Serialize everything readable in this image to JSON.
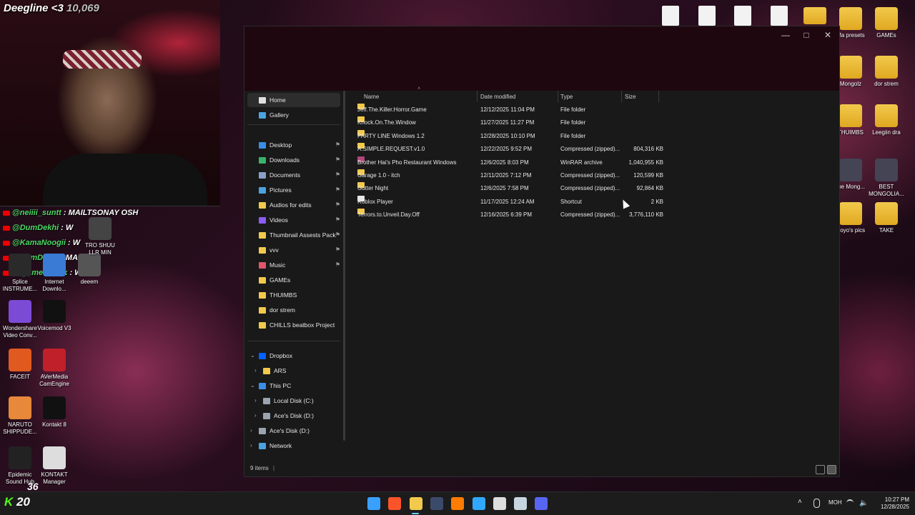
{
  "overlay": {
    "streamer_name": "Deegline <3",
    "streamer_count": "10,069",
    "sub_count": "20",
    "sub_prefix": "K",
    "sticker_count": "36",
    "chat": [
      {
        "user": "@neiiii_suntt",
        "message": "MAILTSONAY OSH"
      },
      {
        "user": "@DumDekhi",
        "message": "W"
      },
      {
        "user": "@KamaNoogii",
        "message": "W"
      },
      {
        "user": "@DumDekhi",
        "message": "MAIIIII"
      },
      {
        "user": "@fgame69-v1k",
        "message": "W"
      }
    ]
  },
  "desktop": {
    "left_icons": [
      {
        "label": "Splice INSTRUME..."
      },
      {
        "label": "Internet Downlo..."
      },
      {
        "label": "deeem"
      },
      {
        "label": "TRO SHUU LLR MIN"
      },
      {
        "label": "Wondershare Video Conv..."
      },
      {
        "label": "Voicemod V3"
      },
      {
        "label": "FACEIT"
      },
      {
        "label": "AVerMedia CamEngine"
      },
      {
        "label": "NARUTO SHIPPUDE..."
      },
      {
        "label": "Kontakt 8"
      },
      {
        "label": "Epidemic Sound Hub"
      },
      {
        "label": "KONTAKT Manager"
      }
    ],
    "right_icons": [
      {
        "label": "Ma presets"
      },
      {
        "label": "GAMEs"
      },
      {
        "label": "Mongolz"
      },
      {
        "label": "dor strem"
      },
      {
        "label": "THUIMBS"
      },
      {
        "label": "Leegiin dra"
      },
      {
        "label": "the Mong..."
      },
      {
        "label": "BEST MONGOLIA..."
      },
      {
        "label": "Soyo's pics"
      },
      {
        "label": "TAKE"
      }
    ]
  },
  "explorer": {
    "window_controls": {
      "minimize": "—",
      "maximize": "□",
      "close": "✕"
    },
    "nav": {
      "home": "Home",
      "gallery": "Gallery",
      "pinned": [
        {
          "label": "Desktop",
          "icon": "desktop-icon",
          "color": "#3a8ee6"
        },
        {
          "label": "Downloads",
          "icon": "download-icon",
          "color": "#38b36b"
        },
        {
          "label": "Documents",
          "icon": "documents-icon",
          "color": "#8aa0c8"
        },
        {
          "label": "Pictures",
          "icon": "pictures-icon",
          "color": "#4aa3df"
        },
        {
          "label": "Audios for edits",
          "icon": "folder-icon",
          "color": "#f2c94c"
        },
        {
          "label": "Videos",
          "icon": "videos-icon",
          "color": "#8b5cf6"
        },
        {
          "label": "Thumbnail Assests Pack",
          "icon": "folder-icon",
          "color": "#f2c94c"
        },
        {
          "label": "vvv",
          "icon": "folder-icon",
          "color": "#f2c94c"
        },
        {
          "label": "Music",
          "icon": "music-icon",
          "color": "#e0566b"
        }
      ],
      "folders": [
        "GAMEs",
        "THUIMBS",
        "dor strem",
        "CHILLS beatbox Project"
      ],
      "dropbox": "Dropbox",
      "ars": "ARS",
      "this_pc": "This PC",
      "drives": [
        "Local Disk (C:)",
        "Ace's Disk (D:)"
      ],
      "aces_disk": "Ace's Disk (D:)",
      "network": "Network"
    },
    "columns": {
      "name": "Name",
      "date": "Date modified",
      "type": "Type",
      "size": "Size"
    },
    "files": [
      {
        "name": "Jeff.The.Killer.Horror.Game",
        "date": "12/12/2025 11:04 PM",
        "type": "File folder",
        "size": "",
        "icon": "folder-icon",
        "color": "#f2c94c"
      },
      {
        "name": "Knock.On.The.Window",
        "date": "11/27/2025 11:27 PM",
        "type": "File folder",
        "size": "",
        "icon": "folder-icon",
        "color": "#f2c94c"
      },
      {
        "name": "PARTY LINE Windows 1.2",
        "date": "12/28/2025 10:10 PM",
        "type": "File folder",
        "size": "",
        "icon": "folder-icon",
        "color": "#f2c94c"
      },
      {
        "name": "A.SIMPLE.REQUEST.v1.0",
        "date": "12/22/2025 9:52 PM",
        "type": "Compressed (zipped)...",
        "size": "804,316 KB",
        "icon": "zip-folder-icon",
        "color": "#f2c94c"
      },
      {
        "name": "Brother Hai's Pho Restaurant Windows",
        "date": "12/6/2025 8:03 PM",
        "type": "WinRAR archive",
        "size": "1,040,955 KB",
        "icon": "winrar-icon",
        "color": "#b0457a"
      },
      {
        "name": "Garage 1.0 - itch",
        "date": "12/11/2025 7:12 PM",
        "type": "Compressed (zipped)...",
        "size": "120,599 KB",
        "icon": "zip-folder-icon",
        "color": "#f2c94c"
      },
      {
        "name": "Gutter Night",
        "date": "12/6/2025 7:58 PM",
        "type": "Compressed (zipped)...",
        "size": "92,864 KB",
        "icon": "zip-folder-icon",
        "color": "#f2c94c"
      },
      {
        "name": "Roblox Player",
        "date": "11/17/2025 12:24 AM",
        "type": "Shortcut",
        "size": "2 KB",
        "icon": "shortcut-icon",
        "color": "#e6e6e6"
      },
      {
        "name": "Terrors.to.Unveil.Day.Off",
        "date": "12/16/2025 6:39 PM",
        "type": "Compressed (zipped)...",
        "size": "3,776,110 KB",
        "icon": "zip-folder-icon",
        "color": "#f2c94c"
      }
    ],
    "status": "9 items"
  },
  "taskbar": {
    "apps": [
      {
        "icon": "windows-start-icon",
        "color": "#3aa0ff"
      },
      {
        "icon": "brave-icon",
        "color": "#fb542b"
      },
      {
        "icon": "file-explorer-icon",
        "color": "#f2c94c"
      },
      {
        "icon": "app-icon",
        "color": "#3b4a6b"
      },
      {
        "icon": "illustrator-icon",
        "color": "#ff7c00"
      },
      {
        "icon": "photoshop-icon",
        "color": "#31a8ff"
      },
      {
        "icon": "live-icon",
        "color": "#dddddd"
      },
      {
        "icon": "steam-icon",
        "color": "#c7d5e0"
      },
      {
        "icon": "discord-icon",
        "color": "#5865f2"
      }
    ],
    "language": "MOH",
    "time": "10:27 PM",
    "date": "12/28/2025"
  }
}
